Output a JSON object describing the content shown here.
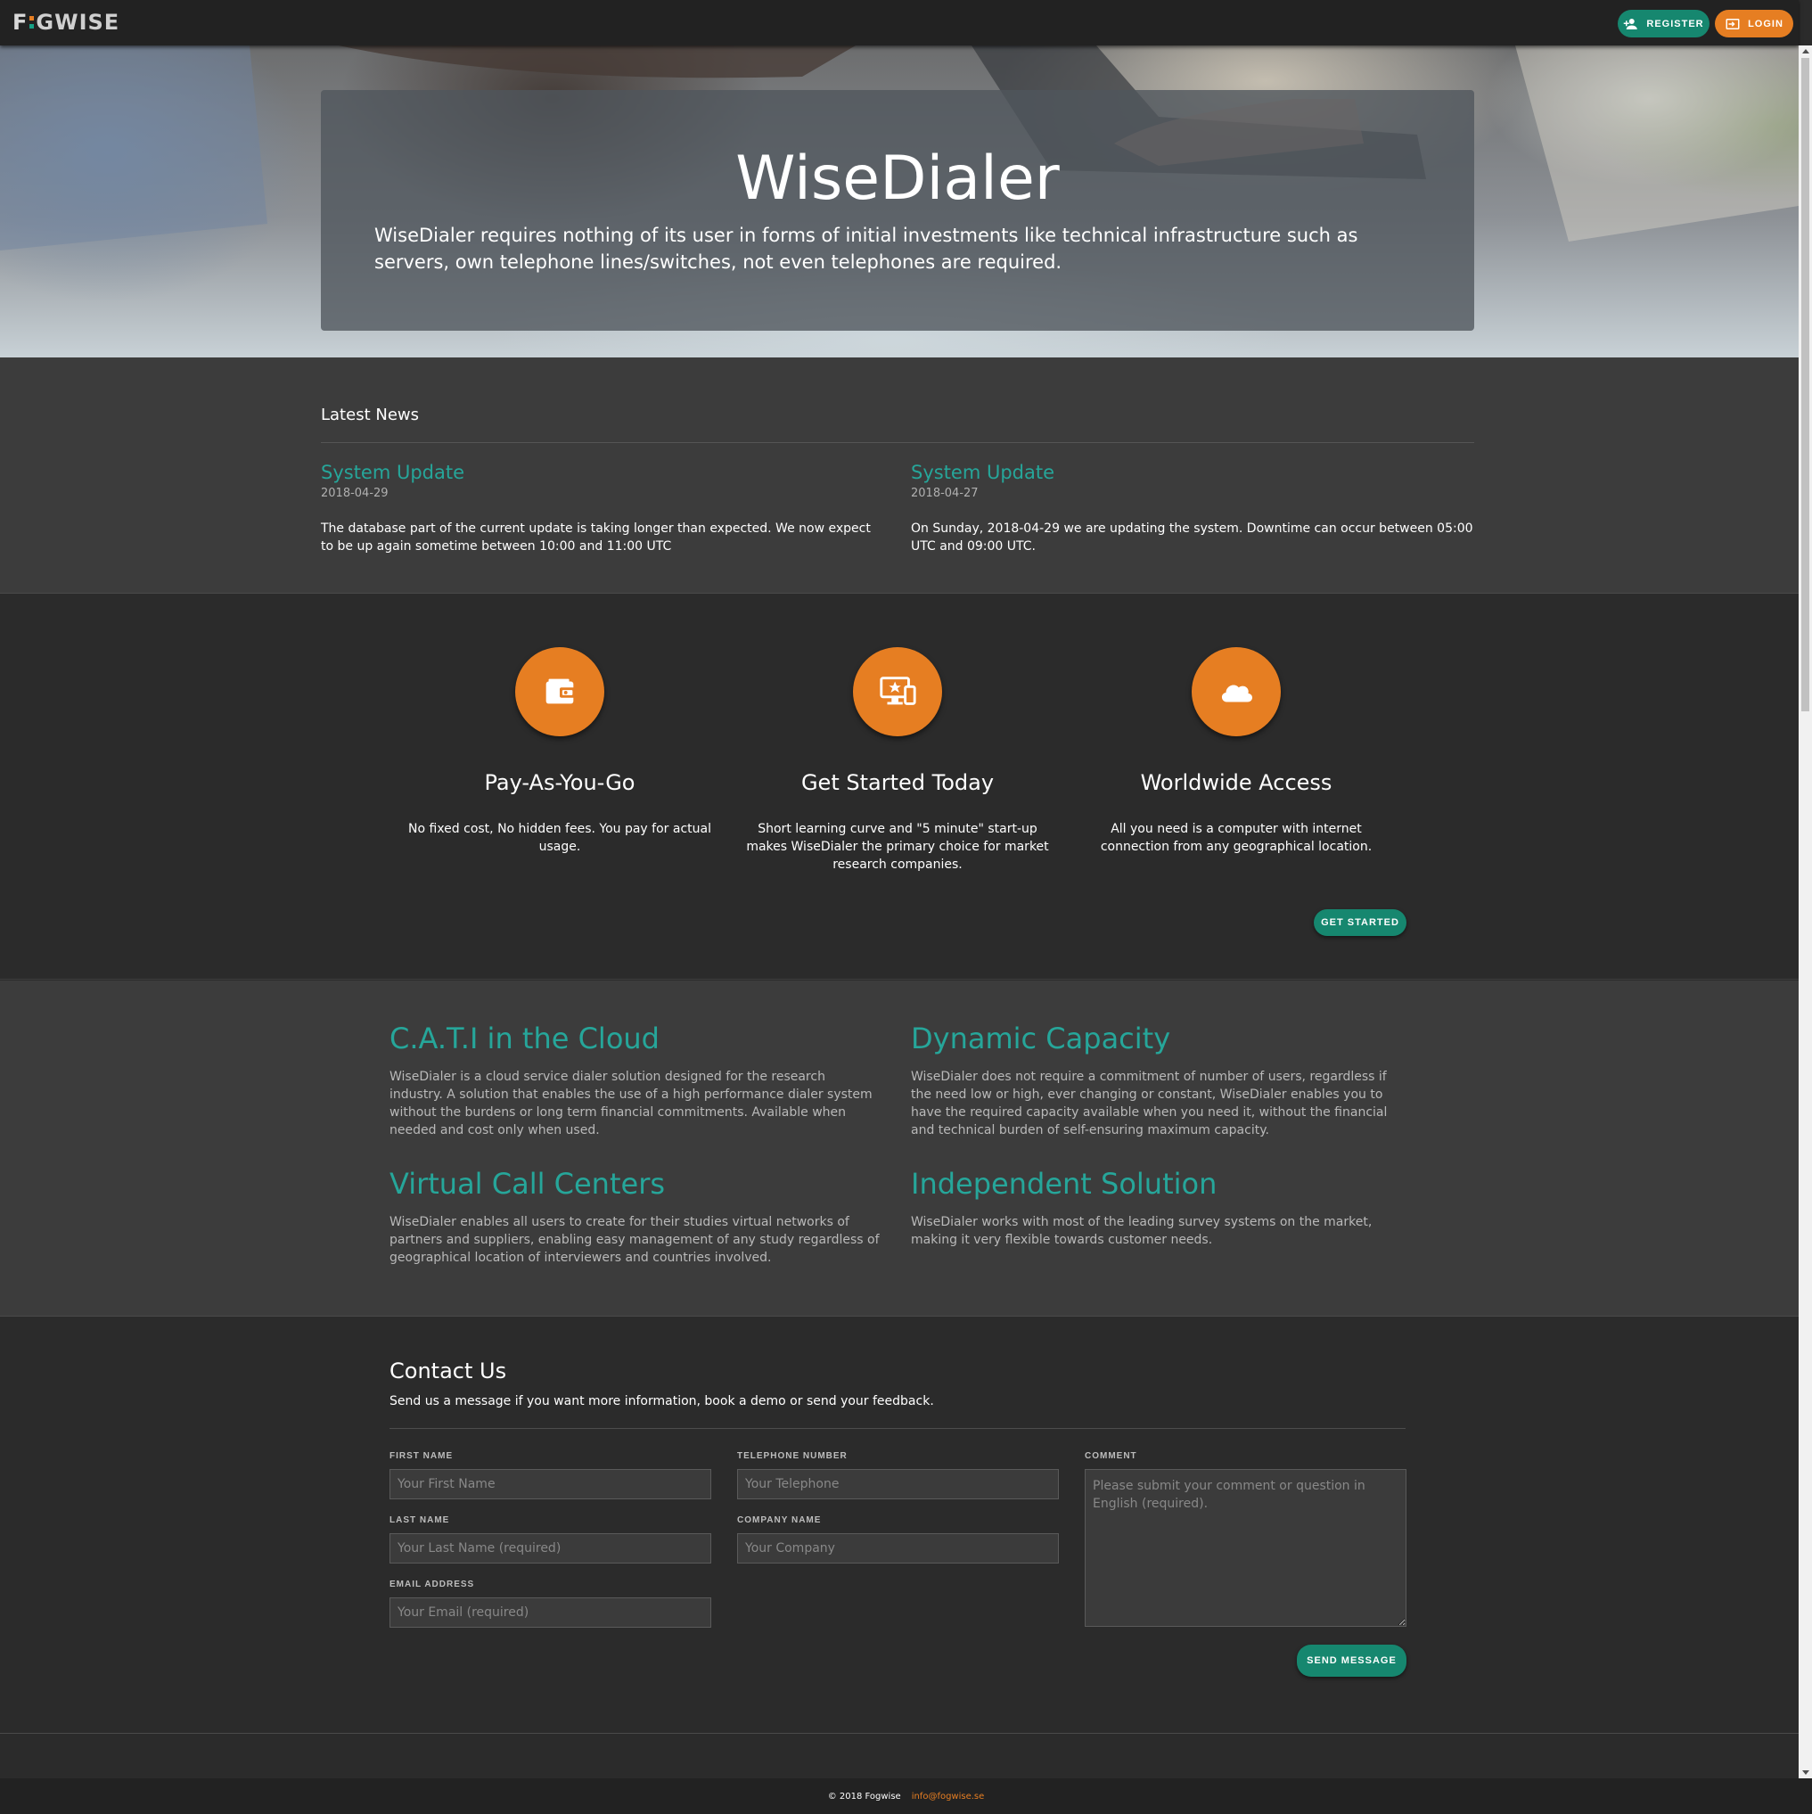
{
  "nav": {
    "logo": "FOGWISE",
    "register_label": "REGISTER",
    "login_label": "LOGIN"
  },
  "hero": {
    "title": "WiseDialer",
    "text": "WiseDialer requires nothing of its user in forms of initial investments like technical infrastructure such as servers, own telephone lines/switches, not even telephones are required."
  },
  "news": {
    "heading": "Latest News",
    "items": [
      {
        "title": "System Update",
        "date": "2018-04-29",
        "body": "The database part of the current update is taking longer than expected. We now expect to be up again sometime between 10:00 and 11:00 UTC"
      },
      {
        "title": "System Update",
        "date": "2018-04-27",
        "body": "On Sunday, 2018-04-29 we are updating the system. Downtime can occur between 05:00 UTC and 09:00 UTC."
      }
    ]
  },
  "features": {
    "items": [
      {
        "icon": "wallet-icon",
        "title": "Pay-As-You-Go",
        "text": "No fixed cost, No hidden fees. You pay for actual usage."
      },
      {
        "icon": "devices-icon",
        "title": "Get Started Today",
        "text": "Short learning curve and \"5 minute\" start-up makes WiseDialer the primary choice for market research companies."
      },
      {
        "icon": "cloud-icon",
        "title": "Worldwide Access",
        "text": "All you need is a computer with internet connection from any geographical location."
      }
    ],
    "cta_label": "GET STARTED"
  },
  "info": {
    "blocks": [
      {
        "title": "C.A.T.I in the Cloud",
        "text": "WiseDialer is a cloud service dialer solution designed for the research industry. A solution that enables the use of a high performance dialer system without the burdens or long term financial commitments. Available when needed and cost only when used."
      },
      {
        "title": "Dynamic Capacity",
        "text": "WiseDialer does not require a commitment of number of users, regardless if the need low or high, ever changing or constant, WiseDialer enables you to have the required capacity available when you need it, without the financial and technical burden of self-ensuring maximum capacity."
      },
      {
        "title": "Virtual Call Centers",
        "text": "WiseDialer enables all users to create for their studies virtual networks of partners and suppliers, enabling easy management of any study regardless of geographical location of interviewers and countries involved."
      },
      {
        "title": "Independent Solution",
        "text": "WiseDialer works with most of the leading survey systems on the market, making it very flexible towards customer needs."
      }
    ]
  },
  "contact": {
    "title": "Contact Us",
    "subtitle": "Send us a message if you want more information, book a demo or send your feedback.",
    "first_name": {
      "label": "FIRST NAME",
      "placeholder": "Your First Name",
      "value": ""
    },
    "last_name": {
      "label": "LAST NAME",
      "placeholder": "Your Last Name (required)",
      "value": ""
    },
    "email": {
      "label": "EMAIL ADDRESS",
      "placeholder": "Your Email (required)",
      "value": ""
    },
    "telephone": {
      "label": "TELEPHONE NUMBER",
      "placeholder": "Your Telephone",
      "value": ""
    },
    "company": {
      "label": "COMPANY NAME",
      "placeholder": "Your Company",
      "value": ""
    },
    "comment": {
      "label": "COMMENT",
      "placeholder": "Please submit your comment or question in English (required).",
      "value": ""
    },
    "send_label": "SEND MESSAGE"
  },
  "footer": {
    "copyright": "© 2018 Fogwise",
    "email": "info@fogwise.se"
  },
  "colors": {
    "accent_orange": "#e67e22",
    "accent_green": "#16876f",
    "teal_heading": "#26a69a",
    "nav_bg": "#222222"
  }
}
